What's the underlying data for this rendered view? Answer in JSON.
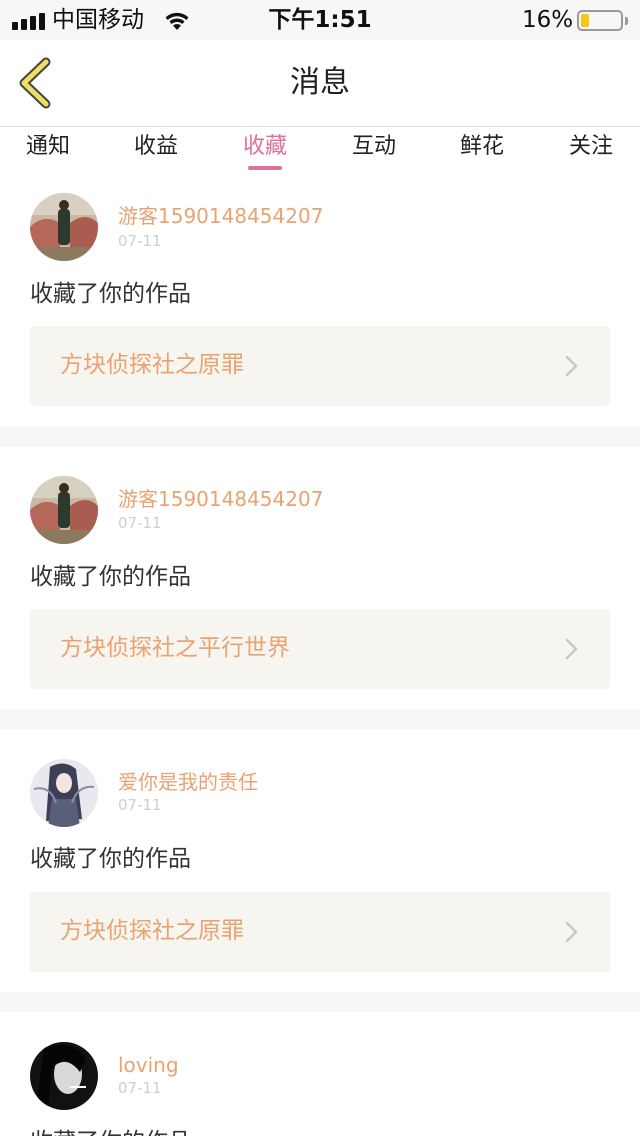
{
  "status_bar": {
    "carrier": "中国移动",
    "time": "下午1:51",
    "battery": "16%",
    "battery_level": 0.16
  },
  "nav": {
    "title": "消息",
    "back_icon": "chevron-left-icon"
  },
  "tabs": [
    {
      "label": "通知",
      "active": false
    },
    {
      "label": "收益",
      "active": false
    },
    {
      "label": "收藏",
      "active": true
    },
    {
      "label": "互动",
      "active": false
    },
    {
      "label": "鲜花",
      "active": false
    },
    {
      "label": "关注",
      "active": false
    }
  ],
  "colors": {
    "accent_pink": "#e0709a",
    "username_orange": "#e9a372",
    "card_bg": "#f6f5ef"
  },
  "messages": [
    {
      "username": "游客1590148454207",
      "date": "07-11",
      "action": "收藏了你的作品",
      "work": "方块侦探社之原罪",
      "avatar_icon": "avatar-photo-rock-icon"
    },
    {
      "username": "游客1590148454207",
      "date": "07-11",
      "action": "收藏了你的作品",
      "work": "方块侦探社之平行世界",
      "avatar_icon": "avatar-photo-rock-icon"
    },
    {
      "username": "爱你是我的责任",
      "date": "07-11",
      "action": "收藏了你的作品",
      "work": "方块侦探社之原罪",
      "avatar_icon": "avatar-anime-girl-icon"
    },
    {
      "username": "loving",
      "date": "07-11",
      "action": "收藏了你的作品",
      "work": "",
      "avatar_icon": "avatar-bw-portrait-icon"
    }
  ]
}
